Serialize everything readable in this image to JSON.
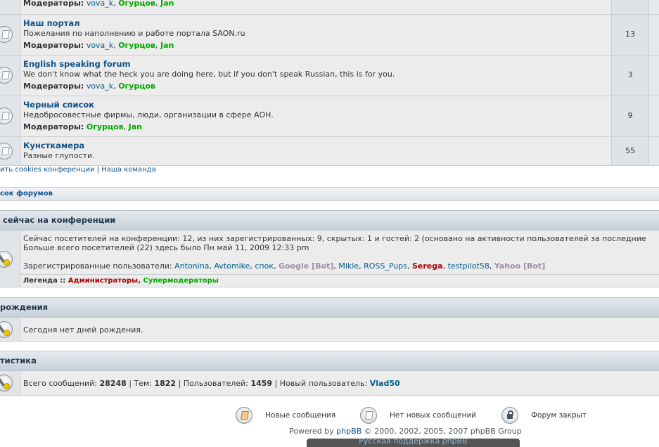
{
  "forums": [
    {
      "title": "",
      "description": "",
      "moderators_label": "Модераторы:",
      "moderators": [
        {
          "name": "vova_k",
          "style": "teal"
        },
        {
          "name": "Огурцов",
          "style": "green"
        },
        {
          "name": "Jan",
          "style": "green"
        }
      ],
      "count": ""
    },
    {
      "title": "Наш портал",
      "description": "Пожелания по наполнению и работе портала SAON.ru",
      "moderators_label": "Модераторы:",
      "moderators": [
        {
          "name": "vova_k",
          "style": "teal"
        },
        {
          "name": "Огурцов",
          "style": "green"
        },
        {
          "name": "Jan",
          "style": "green"
        }
      ],
      "count": "13"
    },
    {
      "title": "English speaking forum",
      "description": "We don't know what the heck you are doing here, but if you don't speak Russian, this is for you.",
      "moderators_label": "Модераторы:",
      "moderators": [
        {
          "name": "vova_k",
          "style": "teal"
        },
        {
          "name": "Огурцов",
          "style": "green"
        }
      ],
      "count": "3"
    },
    {
      "title": "Черный список",
      "description": "Недобросовестные фирмы, люди, организации в сфере АОН.",
      "moderators_label": "Модераторы:",
      "moderators": [
        {
          "name": "Огурцов",
          "style": "green"
        },
        {
          "name": "Jan",
          "style": "green"
        }
      ],
      "count": "9"
    },
    {
      "title": "Кунсткамера",
      "description": "Разные глупости.",
      "moderators_label": "",
      "moderators": [],
      "count": "55"
    }
  ],
  "links": {
    "delete_cookies": "ить cookies конференции",
    "separator": "|",
    "our_team": "Наша команда"
  },
  "forum_list_bar": "сок форумов",
  "online": {
    "heading": "сейчас на конференции",
    "line1": "Сейчас посетителей на конференции: 12, из них зарегистрированных: 9, скрытых: 1 и гостей: 2 (основано на активности пользователей за последние",
    "line2": "Больше всего посетителей (22) здесь было Пн май 11, 2009 12:33 pm",
    "registered_label": "Зарегистрированные пользователи:",
    "users": [
      {
        "name": "Antonina",
        "style": "teal"
      },
      {
        "name": "Avtomike",
        "style": "teal"
      },
      {
        "name": "спок",
        "style": "teal"
      },
      {
        "name": "Google [Bot]",
        "style": "gray"
      },
      {
        "name": "Mikle",
        "style": "teal"
      },
      {
        "name": "ROSS_Pups",
        "style": "teal"
      },
      {
        "name": "Serega",
        "style": "red"
      },
      {
        "name": "testpilot58",
        "style": "teal"
      },
      {
        "name": "Yahoo [Bot]",
        "style": "gray"
      }
    ],
    "legend_label": "Легенда ::",
    "legend_admins": "Администраторы",
    "legend_supermods": "Супермодераторы"
  },
  "birthdays": {
    "heading": "рождения",
    "text": "Сегодня нет дней рождения."
  },
  "stats": {
    "heading": "тистика",
    "posts_label": "Всего сообщений:",
    "posts": "28248",
    "topics_label": "Тем:",
    "topics": "1822",
    "users_label": "Пользователей:",
    "users": "1459",
    "newest_label": "Новый пользователь:",
    "newest": "Vlad50"
  },
  "footer_legend": {
    "new_posts": "Новые сообщения",
    "no_new_posts": "Нет новых сообщений",
    "locked": "Форум закрыт"
  },
  "powered": {
    "prefix": "Powered by",
    "phpbb": "phpBB",
    "suffix": "© 2000, 2002, 2005, 2007 phpBB Group",
    "russian": "Русская поддержка phpBB"
  },
  "colors": {
    "link": "#105289",
    "teal": "#00608b",
    "green": "#00aa00",
    "admin_red": "#aa0000",
    "bot_gray": "#9e8da7"
  }
}
